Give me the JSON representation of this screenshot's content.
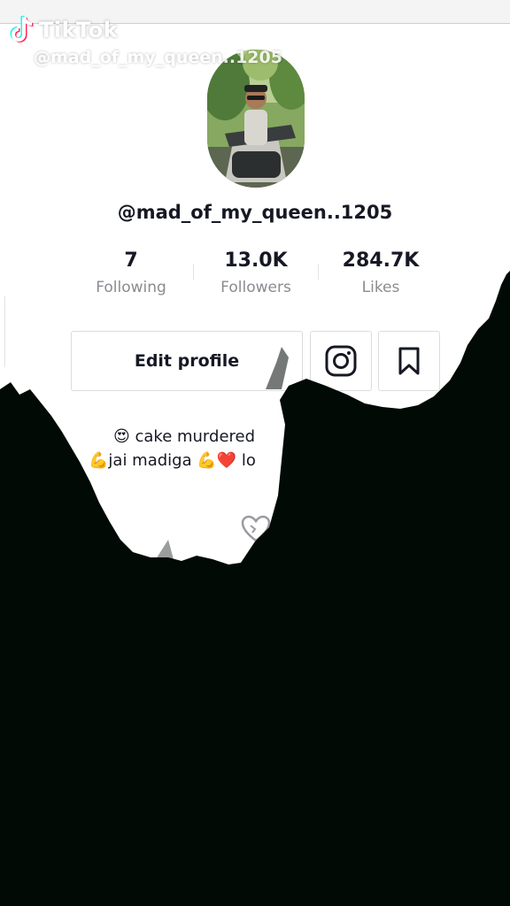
{
  "watermark": {
    "brand": "TikTok",
    "handle": "@mad_of_my_queen..1205"
  },
  "profile": {
    "username": "@mad_of_my_queen..1205",
    "stats": [
      {
        "value": "7",
        "label": "Following"
      },
      {
        "value": "13.0K",
        "label": "Followers"
      },
      {
        "value": "284.7K",
        "label": "Likes"
      }
    ],
    "edit_button": "Edit profile",
    "bio": {
      "line1": "😍 cake murdered",
      "line2": "💪jai madiga 💪❤️ lo"
    }
  },
  "icons": [
    "tiktok-logo-icon",
    "user-icon",
    "instagram-icon",
    "bookmark-icon",
    "heart-icon"
  ],
  "colors": {
    "text": "#161823",
    "secondary_text": "#8a8b91",
    "border": "#dcdcde",
    "dark_overlay": "#020a06"
  }
}
